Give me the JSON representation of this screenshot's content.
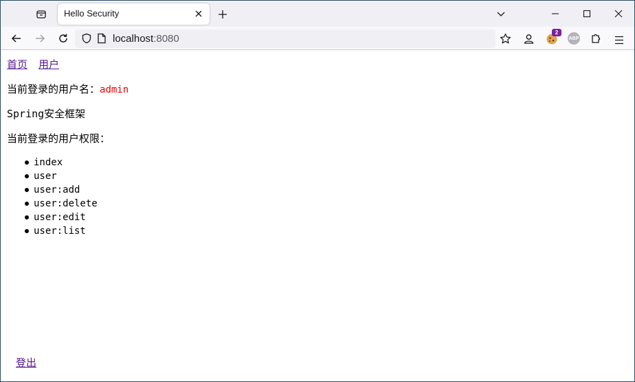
{
  "browser": {
    "tab_title": "Hello Security",
    "url_host": "localhost",
    "url_port": ":8080",
    "extension_badge": "2",
    "abp_label": "ABP"
  },
  "page": {
    "nav": {
      "home": "首页",
      "users": "用户"
    },
    "username_label": "当前登录的用户名：",
    "username_value": "admin",
    "framework_text": "Spring安全框架",
    "authorities_label": "当前登录的用户权限：",
    "authorities": [
      "index",
      "user",
      "user:add",
      "user:delete",
      "user:edit",
      "user:list"
    ],
    "logout": "登出"
  },
  "colors": {
    "link": "#551a8b",
    "username": "#ee0000",
    "badge": "#7b1fa2"
  }
}
